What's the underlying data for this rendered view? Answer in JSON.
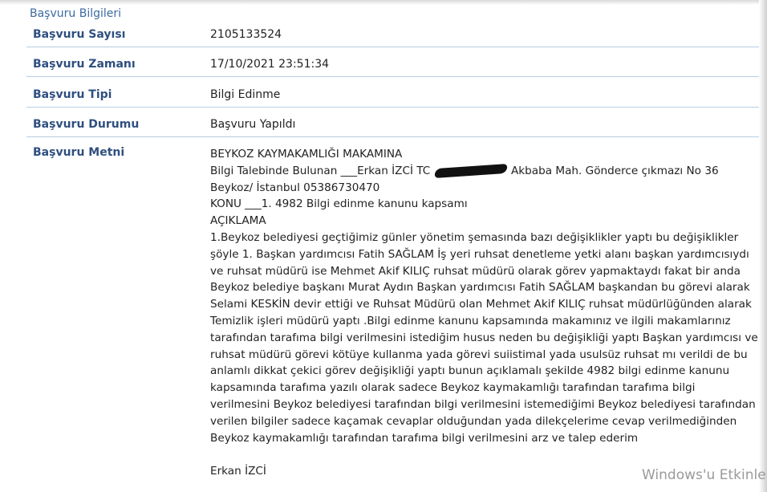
{
  "section_title": "Başvuru Bilgileri",
  "fields": {
    "sayi": {
      "label": "Başvuru Sayısı",
      "value": "2105133524"
    },
    "zaman": {
      "label": "Başvuru Zamanı",
      "value": "17/10/2021 23:51:34"
    },
    "tipi": {
      "label": "Başvuru Tipi",
      "value": "Bilgi Edinme"
    },
    "durumu": {
      "label": "Başvuru Durumu",
      "value": "Başvuru Yapıldı"
    },
    "metni": {
      "label": "Başvuru Metni"
    }
  },
  "metin": {
    "l1": "BEYKOZ KAYMAKAMLIĞI MAKAMINA",
    "l2a": "Bilgi Talebinde Bulunan ___Erkan İZCİ TC",
    "l2b": "Akbaba Mah. Gönderce çıkmazı No 36",
    "l3": "Beykoz/ İstanbul 05386730470",
    "l4": "KONU ___1. 4982 Bilgi edinme kanunu kapsamı",
    "l5": "AÇIKLAMA",
    "p": [
      "1.Beykoz belediyesi geçtiğimiz günler yönetim şemasında bazı değişiklikler yaptı bu değişiklikler",
      "şöyle 1. Başkan yardımcısı Fatih SAĞLAM İş yeri ruhsat denetleme yetki alanı başkan yardımcısıydı",
      "ve ruhsat müdürü ise Mehmet Akif KILIÇ ruhsat müdürü olarak görev yapmaktaydı fakat bir anda",
      "Beykoz belediye başkanı Murat Aydın Başkan yardımcısı Fatih SAĞLAM başkandan bu görevi alarak",
      "Selami KESKİN devir ettiği ve Ruhsat Müdürü olan Mehmet Akif KILIÇ ruhsat müdürlüğünden alarak",
      "Temizlik işleri müdürü yaptı .Bilgi edinme kanunu kapsamında makamınız ve ilgili makamlarınız",
      "tarafından tarafıma bilgi verilmesini istediğim husus neden bu değişikliği yaptı Başkan yardımcısı ve",
      "ruhsat müdürü görevi kötüye kullanma yada görevi suiistimal yada usulsüz ruhsat mı verildi de bu",
      "anlamlı dikkat çekici görev değişikliği yaptı bunun açıklamalı şekilde 4982 bilgi edinme kanunu",
      "kapsamında tarafıma yazılı olarak sadece Beykoz kaymakamlığı tarafından tarafıma bilgi",
      "verilmesini Beykoz belediyesi tarafından bilgi verilmesini istemediğimi Beykoz belediyesi tarafından",
      "verilen bilgiler sadece kaçamak cevaplar olduğundan yada dilekçelerime cevap verilmediğinden",
      "Beykoz kaymakamlığı tarafından tarafıma bilgi verilmesini arz ve talep ederim"
    ],
    "signature": "Erkan İZCİ"
  },
  "watermark": "Windows'u Etkinle"
}
